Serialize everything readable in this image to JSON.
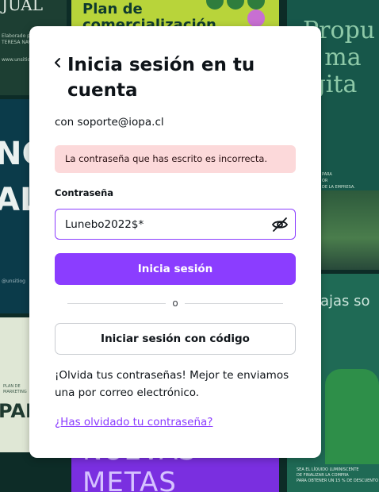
{
  "background": {
    "tile_top_left": {
      "title": "JUAL",
      "lines": [
        "Elaborado por:",
        "TERESA NAV",
        "www.unsitiog"
      ]
    },
    "tile_top_center": {
      "title": "Plan de\ncomercialización"
    },
    "tile_top_right": {
      "title": "Propu\ne ma\nigita",
      "small": "PARA\nOR\nDE LA EMPRESA."
    },
    "tile_mid_left": {
      "title": "NG\nAL",
      "handle": "@unsitiog"
    },
    "tile_bottom_left": {
      "lines": [
        "PLAN DE",
        "MARKETING"
      ],
      "title": "PAÑ"
    },
    "tile_bottom_center": {
      "title": "NUEVAS\nMETAS"
    },
    "tile_bottom_right": {
      "title": "ajas so",
      "small": "SEA EL LÍQUIDO LUMINISCENTE\nDE FINALIZAR LA COMPRA\nPARA OBTENER UN 15 % DE DESCUENTO"
    }
  },
  "dialog": {
    "back_icon": "chevron-left-icon",
    "title": "Inicia sesión en tu cuenta",
    "email_line": "con soporte@iopa.cl",
    "error_message": "La contraseña que has escrito es incorrecta.",
    "password_label": "Contraseña",
    "password_value": "Lunebo2022$*",
    "eye_icon": "eye-off-icon",
    "primary_button": "Inicia sesión",
    "divider_text": "o",
    "secondary_button": "Iniciar sesión con código",
    "info_text": "¡Olvida tus contraseñas! Mejor te enviamos una por correo electrónico.",
    "forgot_link": "¿Has olvidado tu contraseña?"
  },
  "colors": {
    "accent": "#8b3dff",
    "error_bg": "#fcd9da",
    "text": "#0e1318"
  }
}
